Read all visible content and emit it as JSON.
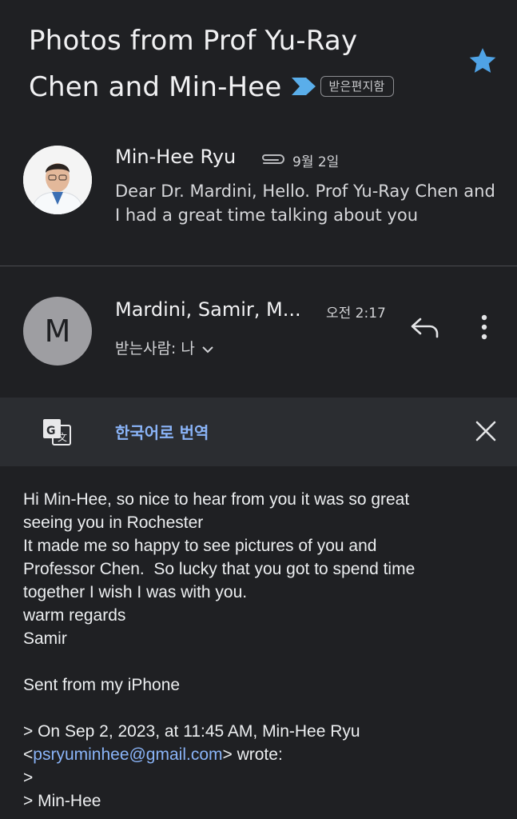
{
  "subject": {
    "line1": "Photos from Prof Yu-Ray",
    "line2": "Chen and Min-Hee",
    "label_chip": "받은편지함",
    "importance_icon": "importance-marker-icon",
    "starred": true
  },
  "thread": [
    {
      "sender": "Min-Hee Ryu",
      "has_attachment": true,
      "date": "9월 2일",
      "snippet": "Dear Dr. Mardini, Hello. Prof Yu-Ray Chen and I had a great time talking about you"
    },
    {
      "avatar_letter": "M",
      "sender": "Mardini, Samir, M...",
      "time": "오전 2:17",
      "recipient": "받는사람: 나"
    }
  ],
  "translate_bar": {
    "link_label": "한국어로 번역"
  },
  "body": {
    "lines": [
      "Hi Min-Hee, so nice to hear from you it was so great",
      "seeing you in Rochester",
      "It made me so happy to see pictures of you and",
      "Professor Chen.  So lucky that you got to spend time",
      "together I wish I was with you.",
      "warm regards",
      "Samir",
      "",
      "Sent from my iPhone",
      "",
      "> On Sep 2, 2023, at 11:45 AM, Min-Hee Ryu"
    ],
    "quote_email_prefix": "<",
    "quote_email": "psryuminhee@gmail.com",
    "quote_email_suffix": "> wrote:",
    "after_lines": [
      ">",
      "> Min-Hee"
    ]
  },
  "colors": {
    "background": "#1f2023",
    "star": "#4fa3e6",
    "link": "#8ab4f8",
    "translate_bar": "#2b2d31"
  }
}
